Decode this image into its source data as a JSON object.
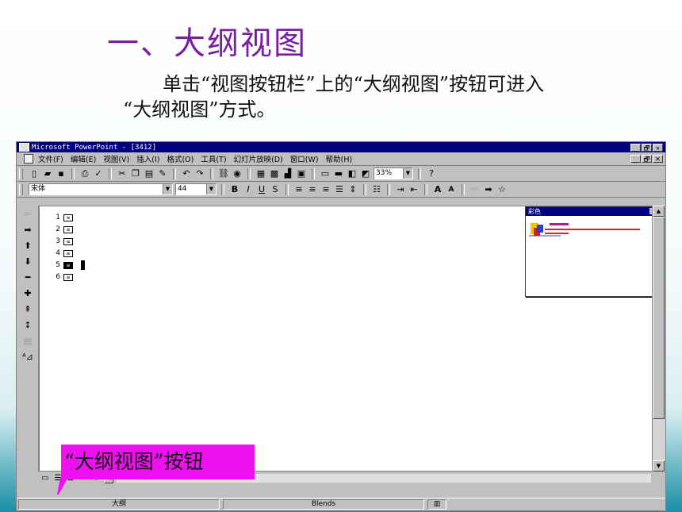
{
  "slide": {
    "title": "一、大纲视图",
    "body_line1": "单击“视图按钮栏”上的“大纲视图”按钮可进入",
    "body_line2": "“大纲视图”方式。",
    "callout": "“大纲视图”按钮"
  },
  "window": {
    "title": "Microsoft PowerPoint - [3412]",
    "controls": [
      "_",
      "🗗",
      "✕"
    ],
    "menu": [
      "文件(F)",
      "编辑(E)",
      "视图(V)",
      "插入(I)",
      "格式(O)",
      "工具(T)",
      "幻灯片放映(D)",
      "窗口(W)",
      "帮助(H)"
    ],
    "zoom": "33%",
    "font_name": "宋体",
    "font_size": "44",
    "format_buttons": [
      "B",
      "I",
      "U",
      "S"
    ],
    "outline_slides": [
      "1",
      "2",
      "3",
      "4",
      "5",
      "6"
    ],
    "color_window_title": "彩色",
    "status_view": "大纲",
    "status_design": "Blends"
  },
  "colors": {
    "title": "#7b1fa2",
    "callout_bg": "#ee11ee",
    "titlebar": "#000080",
    "bottom_accent": "#1a8fa6"
  }
}
